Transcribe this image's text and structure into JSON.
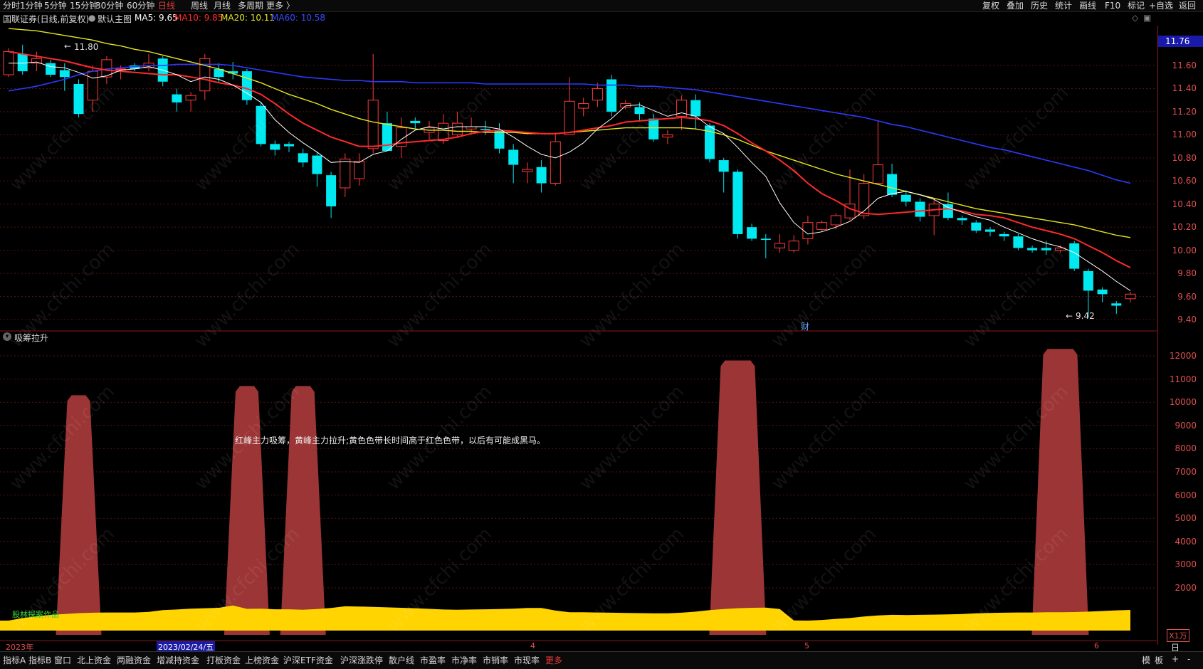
{
  "topbar": {
    "left_items": [
      "分时",
      "1分钟",
      "5分钟",
      "15分钟",
      "30分钟",
      "60分钟",
      "日线",
      "周线",
      "月线",
      "多周期",
      "更多 〉"
    ],
    "active": "日线",
    "right_items": [
      "复权",
      "叠加",
      "历史",
      "统计",
      "画线",
      "F10",
      "标记",
      "+自选",
      "返回"
    ]
  },
  "infobar": {
    "stock": "国联证券(日线,前复权)",
    "chart_name": "默认主图",
    "ma5": "MA5: 9.65",
    "ma10": "MA10: 9.85",
    "ma20": "MA20: 10.11",
    "ma60": "MA60: 10.58",
    "ma5_color": "#ffffff",
    "ma10_color": "#ff2a2a",
    "ma20_color": "#e6e61e",
    "ma60_color": "#2a3aff"
  },
  "price_axis": {
    "current": "11.76",
    "ticks": [
      "11.60",
      "11.40",
      "11.20",
      "11.00",
      "10.80",
      "10.60",
      "10.40",
      "10.20",
      "10.00",
      "9.80",
      "9.60",
      "9.40"
    ]
  },
  "annotations": {
    "high": "11.80",
    "low": "9.42",
    "finance_marker": "财"
  },
  "indicator": {
    "title": "吸筹拉升",
    "note": "红峰主力吸筹，黄峰主力拉升;黄色色带长时间高于红色色带，以后有可能成黑马。",
    "author": "股林探案作品",
    "unit": "X1万",
    "ticks": [
      "12000",
      "11000",
      "10000",
      "9000",
      "8000",
      "7000",
      "6000",
      "5000",
      "4000",
      "3000",
      "2000"
    ],
    "red_color": "#9c3535",
    "yellow_color": "#ffd400"
  },
  "date_axis": {
    "year": "2023年",
    "cursor_date": "2023/02/24/五",
    "months": [
      "4",
      "5",
      "6"
    ],
    "period": "日线"
  },
  "bottombar": {
    "items": [
      "指标A",
      "指标B",
      "窗口",
      "北上资金",
      "两融资金",
      "增减持资金",
      "打板资金",
      "上榜资金",
      "沪深ETF资金",
      "沪深涨跌停",
      "散户线",
      "市盈率",
      "市净率",
      "市销率",
      "市现率",
      "更多"
    ],
    "right_items": [
      "模",
      "板",
      "+",
      "-"
    ]
  },
  "watermark": "www.cfchi.com",
  "chart_data": {
    "type": "candlestick",
    "price_range": [
      9.3,
      11.85
    ],
    "candles": [
      [
        11.52,
        11.72,
        11.75,
        11.5
      ],
      [
        11.7,
        11.55,
        11.78,
        11.52
      ],
      [
        11.62,
        11.66,
        11.72,
        11.55
      ],
      [
        11.62,
        11.52,
        11.65,
        11.5
      ],
      [
        11.56,
        11.5,
        11.62,
        11.38
      ],
      [
        11.44,
        11.18,
        11.48,
        11.15
      ],
      [
        11.3,
        11.55,
        11.6,
        11.2
      ],
      [
        11.5,
        11.65,
        11.68,
        11.44
      ],
      [
        11.57,
        11.57,
        11.6,
        11.48
      ],
      [
        11.6,
        11.57,
        11.62,
        11.55
      ],
      [
        11.58,
        11.62,
        11.7,
        11.55
      ],
      [
        11.66,
        11.46,
        11.68,
        11.42
      ],
      [
        11.35,
        11.28,
        11.4,
        11.2
      ],
      [
        11.3,
        11.34,
        11.37,
        11.2
      ],
      [
        11.38,
        11.66,
        11.7,
        11.3
      ],
      [
        11.57,
        11.5,
        11.62,
        11.45
      ],
      [
        11.55,
        11.53,
        11.63,
        11.48
      ],
      [
        11.55,
        11.3,
        11.57,
        11.26
      ],
      [
        11.25,
        10.92,
        11.28,
        10.9
      ],
      [
        10.92,
        10.87,
        10.95,
        10.82
      ],
      [
        10.92,
        10.9,
        10.94,
        10.85
      ],
      [
        10.84,
        10.76,
        10.88,
        10.72
      ],
      [
        10.82,
        10.66,
        10.85,
        10.55
      ],
      [
        10.65,
        10.38,
        10.68,
        10.28
      ],
      [
        10.54,
        10.79,
        10.84,
        10.46
      ],
      [
        10.62,
        10.77,
        10.84,
        10.56
      ],
      [
        10.88,
        11.3,
        11.7,
        10.84
      ],
      [
        11.1,
        10.86,
        11.2,
        10.86
      ],
      [
        10.9,
        11.06,
        11.15,
        10.8
      ],
      [
        11.12,
        11.1,
        11.15,
        11.05
      ],
      [
        11.02,
        11.06,
        11.12,
        10.96
      ],
      [
        10.95,
        11.1,
        11.18,
        10.92
      ],
      [
        11.0,
        11.1,
        11.2,
        10.98
      ],
      [
        11.05,
        11.07,
        11.15,
        11.0
      ],
      [
        11.05,
        11.04,
        11.12,
        11.0
      ],
      [
        11.04,
        10.88,
        11.1,
        10.84
      ],
      [
        10.87,
        10.74,
        10.92,
        10.58
      ],
      [
        10.68,
        10.7,
        10.76,
        10.58
      ],
      [
        10.72,
        10.58,
        10.78,
        10.5
      ],
      [
        10.58,
        10.94,
        11.02,
        10.56
      ],
      [
        11.0,
        11.29,
        11.5,
        11.0
      ],
      [
        11.23,
        11.27,
        11.32,
        11.16
      ],
      [
        11.3,
        11.4,
        11.45,
        11.24
      ],
      [
        11.48,
        11.2,
        11.52,
        11.16
      ],
      [
        11.24,
        11.27,
        11.3,
        11.22
      ],
      [
        11.24,
        11.18,
        11.28,
        11.12
      ],
      [
        11.14,
        10.96,
        11.18,
        10.94
      ],
      [
        10.98,
        11.0,
        11.04,
        10.92
      ],
      [
        11.16,
        11.3,
        11.34,
        11.04
      ],
      [
        11.3,
        11.16,
        11.35,
        11.05
      ],
      [
        11.08,
        10.79,
        11.1,
        10.76
      ],
      [
        10.78,
        10.68,
        10.8,
        10.5
      ],
      [
        10.68,
        10.14,
        10.7,
        10.1
      ],
      [
        10.2,
        10.1,
        10.23,
        10.08
      ],
      [
        10.1,
        10.09,
        10.14,
        9.93
      ],
      [
        10.02,
        10.06,
        10.14,
        9.98
      ],
      [
        10.0,
        10.08,
        10.13,
        9.98
      ],
      [
        10.1,
        10.24,
        10.3,
        10.05
      ],
      [
        10.18,
        10.24,
        10.26,
        10.16
      ],
      [
        10.22,
        10.3,
        10.32,
        10.18
      ],
      [
        10.28,
        10.4,
        10.7,
        10.26
      ],
      [
        10.3,
        10.58,
        10.66,
        10.27
      ],
      [
        10.58,
        10.74,
        11.12,
        10.58
      ],
      [
        10.66,
        10.48,
        10.75,
        10.46
      ],
      [
        10.48,
        10.42,
        10.52,
        10.38
      ],
      [
        10.42,
        10.29,
        10.45,
        10.25
      ],
      [
        10.3,
        10.4,
        10.45,
        10.13
      ],
      [
        10.4,
        10.28,
        10.5,
        10.26
      ],
      [
        10.28,
        10.26,
        10.3,
        10.22
      ],
      [
        10.24,
        10.17,
        10.26,
        10.15
      ],
      [
        10.18,
        10.16,
        10.2,
        10.12
      ],
      [
        10.14,
        10.12,
        10.16,
        10.08
      ],
      [
        10.12,
        10.02,
        10.14,
        10.0
      ],
      [
        10.02,
        10.0,
        10.04,
        9.98
      ],
      [
        10.02,
        10.0,
        10.08,
        9.96
      ],
      [
        10.0,
        10.02,
        10.04,
        9.98
      ],
      [
        10.06,
        9.84,
        10.08,
        9.82
      ],
      [
        9.82,
        9.65,
        9.84,
        9.42
      ],
      [
        9.66,
        9.62,
        9.68,
        9.55
      ],
      [
        9.54,
        9.52,
        9.56,
        9.45
      ],
      [
        9.58,
        9.62,
        9.64,
        9.55
      ]
    ],
    "ma5": [
      11.62,
      11.62,
      11.63,
      11.59,
      11.58,
      11.54,
      11.49,
      11.51,
      11.56,
      11.57,
      11.59,
      11.56,
      11.52,
      11.46,
      11.5,
      11.48,
      11.43,
      11.36,
      11.28,
      11.13,
      11.02,
      10.93,
      10.85,
      10.76,
      10.77,
      10.76,
      10.83,
      10.86,
      10.96,
      11.04,
      11.07,
      11.05,
      11.07,
      11.07,
      11.07,
      11.05,
      10.98,
      10.9,
      10.83,
      10.8,
      10.85,
      10.93,
      11.05,
      11.14,
      11.25,
      11.26,
      11.21,
      11.16,
      11.19,
      11.16,
      11.07,
      11.01,
      10.89,
      10.76,
      10.64,
      10.41,
      10.24,
      10.14,
      10.16,
      10.2,
      10.25,
      10.34,
      10.45,
      10.49,
      10.51,
      10.48,
      10.44,
      10.37,
      10.33,
      10.29,
      10.26,
      10.2,
      10.15,
      10.1,
      10.06,
      10.03,
      9.98,
      9.9,
      9.82,
      9.73,
      9.65
    ],
    "ma10": [
      11.72,
      11.7,
      11.68,
      11.66,
      11.64,
      11.61,
      11.58,
      11.56,
      11.55,
      11.54,
      11.53,
      11.52,
      11.52,
      11.5,
      11.48,
      11.45,
      11.43,
      11.4,
      11.35,
      11.27,
      11.18,
      11.1,
      11.04,
      10.98,
      10.94,
      10.9,
      10.9,
      10.91,
      10.93,
      10.94,
      10.95,
      10.96,
      10.98,
      11.01,
      11.03,
      11.04,
      11.03,
      11.02,
      11.01,
      11.01,
      11.02,
      11.04,
      11.06,
      11.08,
      11.11,
      11.12,
      11.13,
      11.14,
      11.15,
      11.14,
      11.12,
      11.08,
      11.01,
      10.93,
      10.86,
      10.78,
      10.69,
      10.58,
      10.49,
      10.43,
      10.36,
      10.32,
      10.31,
      10.32,
      10.33,
      10.34,
      10.35,
      10.36,
      10.34,
      10.31,
      10.3,
      10.28,
      10.24,
      10.2,
      10.17,
      10.14,
      10.1,
      10.04,
      9.98,
      9.91,
      9.85
    ],
    "ma20": [
      11.92,
      11.91,
      11.9,
      11.88,
      11.86,
      11.84,
      11.82,
      11.79,
      11.77,
      11.74,
      11.72,
      11.69,
      11.66,
      11.63,
      11.6,
      11.57,
      11.53,
      11.49,
      11.45,
      11.4,
      11.35,
      11.31,
      11.27,
      11.22,
      11.18,
      11.14,
      11.11,
      11.09,
      11.07,
      11.05,
      11.04,
      11.04,
      11.03,
      11.03,
      11.02,
      11.02,
      11.02,
      11.01,
      11.01,
      11.01,
      11.02,
      11.03,
      11.04,
      11.05,
      11.06,
      11.06,
      11.06,
      11.06,
      11.06,
      11.05,
      11.03,
      11.0,
      10.96,
      10.91,
      10.86,
      10.82,
      10.78,
      10.74,
      10.7,
      10.66,
      10.63,
      10.6,
      10.57,
      10.54,
      10.51,
      10.48,
      10.45,
      10.42,
      10.39,
      10.36,
      10.34,
      10.32,
      10.3,
      10.28,
      10.26,
      10.24,
      10.22,
      10.19,
      10.16,
      10.13,
      10.11
    ],
    "ma60": [
      11.38,
      11.4,
      11.42,
      11.45,
      11.48,
      11.52,
      11.55,
      11.57,
      11.58,
      11.59,
      11.6,
      11.6,
      11.61,
      11.61,
      11.61,
      11.61,
      11.6,
      11.58,
      11.56,
      11.54,
      11.52,
      11.5,
      11.49,
      11.48,
      11.47,
      11.47,
      11.46,
      11.46,
      11.46,
      11.45,
      11.45,
      11.45,
      11.45,
      11.45,
      11.44,
      11.44,
      11.44,
      11.44,
      11.44,
      11.44,
      11.44,
      11.44,
      11.43,
      11.43,
      11.43,
      11.42,
      11.42,
      11.41,
      11.4,
      11.39,
      11.37,
      11.35,
      11.33,
      11.31,
      11.29,
      11.27,
      11.25,
      11.23,
      11.21,
      11.19,
      11.17,
      11.15,
      11.12,
      11.09,
      11.07,
      11.04,
      11.01,
      10.98,
      10.95,
      10.92,
      10.89,
      10.87,
      10.84,
      10.81,
      10.78,
      10.75,
      10.72,
      10.69,
      10.65,
      10.61,
      10.58
    ],
    "indicator_range": [
      0,
      13000
    ],
    "red_peaks": [
      {
        "i": 5,
        "v": 10300
      },
      {
        "i": 17,
        "v": 10700
      },
      {
        "i": 21,
        "v": 10700
      },
      {
        "i": 52,
        "v": 11800
      },
      {
        "i": 75,
        "v": 12300
      }
    ],
    "yellow_band": [
      500,
      620,
      700,
      770,
      810,
      850,
      870,
      880,
      880,
      880,
      910,
      990,
      1020,
      1060,
      1080,
      1100,
      1210,
      1050,
      1060,
      1030,
      1030,
      1010,
      1040,
      1090,
      1170,
      1160,
      1140,
      1120,
      1100,
      1080,
      1050,
      1020,
      1010,
      1020,
      1030,
      1040,
      1060,
      1090,
      1090,
      970,
      890,
      890,
      880,
      870,
      860,
      850,
      840,
      840,
      870,
      920,
      990,
      1040,
      1080,
      1100,
      1110,
      1040,
      510,
      500,
      530,
      580,
      620,
      690,
      740,
      770,
      760,
      770,
      780,
      790,
      810,
      840,
      860,
      870,
      880,
      880,
      890,
      890,
      900,
      920,
      950,
      980,
      1000
    ]
  }
}
